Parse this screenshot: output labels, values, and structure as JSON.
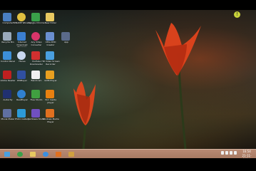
{
  "desktop": {
    "icons": [
      {
        "name": "computer-icon",
        "label": "Computer",
        "color": "#4a7fc1"
      },
      {
        "name": "winamp-icon",
        "label": "WINAMP Winamp",
        "color": "#e0c040"
      },
      {
        "name": "google-chrome-icon",
        "label": "Google Chrome",
        "color": "#3aa04a"
      },
      {
        "name": "new-folder-icon",
        "label": "New folder",
        "color": "#e8c860"
      },
      {
        "name": "recycle-bin-icon",
        "label": "Recycle Bin",
        "color": "#9ab"
      },
      {
        "name": "internet-download-icon",
        "label": "Internet Download Manager",
        "color": "#3b7fd0"
      },
      {
        "name": "any-video-converter-icon",
        "label": "Any Video Converter",
        "color": "#d8356a"
      },
      {
        "name": "ultra-dvd-creator-icon",
        "label": "Ultra DVD Creator",
        "color": "#6a8fd0"
      },
      {
        "name": "control-panel-icon",
        "label": "Control Panel",
        "color": "#3c8fd8"
      },
      {
        "name": "itunes-icon",
        "label": "iTunes",
        "color": "#c8d8f0"
      },
      {
        "name": "youtube-downloader-icon",
        "label": "YouTube Downloader",
        "color": "#d03030"
      },
      {
        "name": "hd-video-icon",
        "label": "HD Video Screen Recorder",
        "color": "#4aa0e0"
      },
      {
        "name": "gom-player-icon",
        "label": "GOM Player",
        "color": "#e8a020"
      },
      {
        "name": "bandicam-icon",
        "label": "Bandicam",
        "color": "#f0f0f0"
      },
      {
        "name": "realplayer-icon",
        "label": "RealPlayer",
        "color": "#3080d0"
      },
      {
        "name": "adobe-reader-icon",
        "label": "Adobe Reader",
        "color": "#c02020"
      },
      {
        "name": "kmplayer-icon",
        "label": "KMPlayer",
        "color": "#3050a0"
      },
      {
        "name": "vlc-icon",
        "label": "VLC media player",
        "color": "#e88010"
      },
      {
        "name": "audacity-icon",
        "label": "Audacity",
        "color": "#203070"
      },
      {
        "name": "free-studio-icon",
        "label": "Free Studio",
        "color": "#40a040"
      },
      {
        "name": "movie-maker-icon",
        "label": "Movie Maker",
        "color": "#6070a0"
      },
      {
        "name": "photo-gallery-icon",
        "label": "Photo Gallery",
        "color": "#2c9ad8"
      },
      {
        "name": "camtasia-icon",
        "label": "Camtasia Studio",
        "color": "#7050c0"
      },
      {
        "name": "media-player-icon",
        "label": "Windows Media Player",
        "color": "#e07020"
      },
      {
        "name": "app-icon",
        "label": "App",
        "color": "#5a6a8a"
      }
    ],
    "notification_badge": "!"
  },
  "taskbar": {
    "buttons": [
      {
        "name": "start-button",
        "label": "Start",
        "color": "#4aa0e0"
      },
      {
        "name": "chrome-taskbar-button",
        "label": "Google Chrome",
        "color": "#3aa04a"
      },
      {
        "name": "explorer-taskbar-button",
        "label": "File Explorer",
        "color": "#e8c860"
      },
      {
        "name": "ie-taskbar-button",
        "label": "Internet Explorer",
        "color": "#3b8fe0"
      },
      {
        "name": "media-taskbar-button",
        "label": "Windows Media Player",
        "color": "#e07020"
      },
      {
        "name": "app-taskbar-button",
        "label": "App",
        "color": "#d0a040"
      }
    ],
    "clock": {
      "time": "16:54",
      "date": "21-11-2014"
    }
  }
}
